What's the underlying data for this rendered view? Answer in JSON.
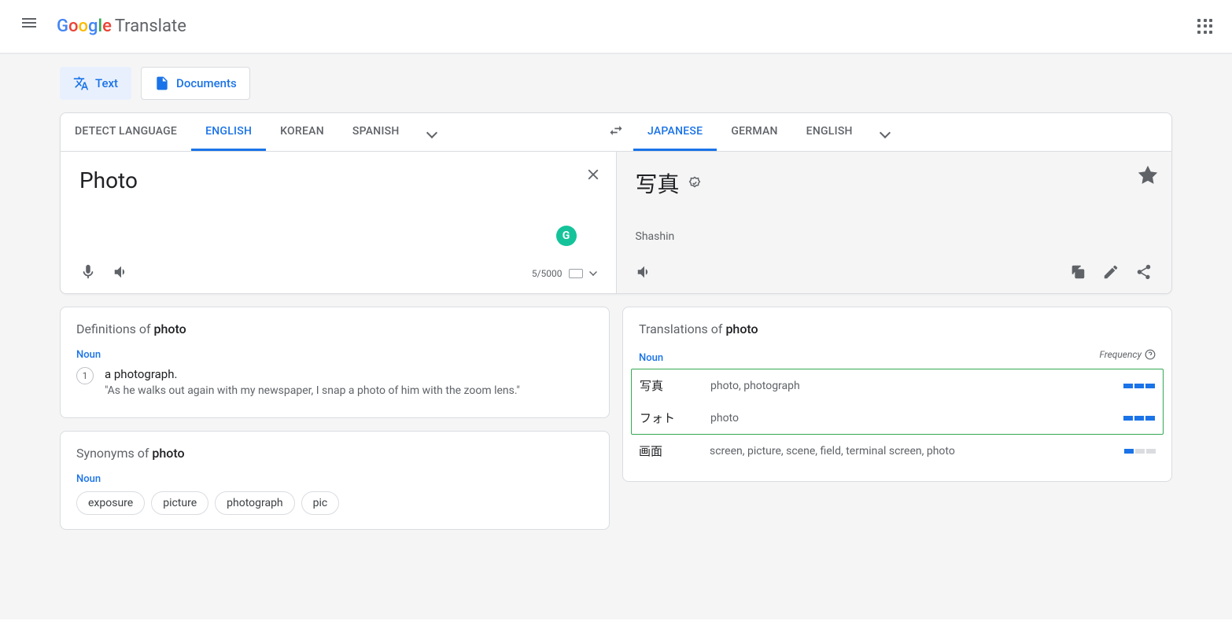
{
  "header": {
    "logo_translate": "Translate"
  },
  "modes": {
    "text": "Text",
    "documents": "Documents"
  },
  "source_langs": {
    "detect": "DETECT LANGUAGE",
    "l1": "ENGLISH",
    "l2": "KOREAN",
    "l3": "SPANISH"
  },
  "target_langs": {
    "l1": "JAPANESE",
    "l2": "GERMAN",
    "l3": "ENGLISH"
  },
  "input": {
    "text": "Photo",
    "char_count": "5/5000"
  },
  "output": {
    "text": "写真",
    "romanization": "Shashin"
  },
  "definitions": {
    "title_prefix": "Definitions of ",
    "title_word": "photo",
    "pos": "Noun",
    "items": [
      {
        "num": "1",
        "text": "a photograph.",
        "example": "\"As he walks out again with my newspaper, I snap a photo of him with the zoom lens.\""
      }
    ]
  },
  "synonyms": {
    "title_prefix": "Synonyms of ",
    "title_word": "photo",
    "pos": "Noun",
    "items": [
      "exposure",
      "picture",
      "photograph",
      "pic"
    ]
  },
  "translations": {
    "title_prefix": "Translations of ",
    "title_word": "photo",
    "pos": "Noun",
    "freq_label": "Frequency",
    "items": [
      {
        "word": "写真",
        "meanings": "photo, photograph",
        "freq": 3
      },
      {
        "word": "フォト",
        "meanings": "photo",
        "freq": 3
      },
      {
        "word": "画面",
        "meanings": "screen, picture, scene, field, terminal screen, photo",
        "freq": 1
      }
    ]
  }
}
